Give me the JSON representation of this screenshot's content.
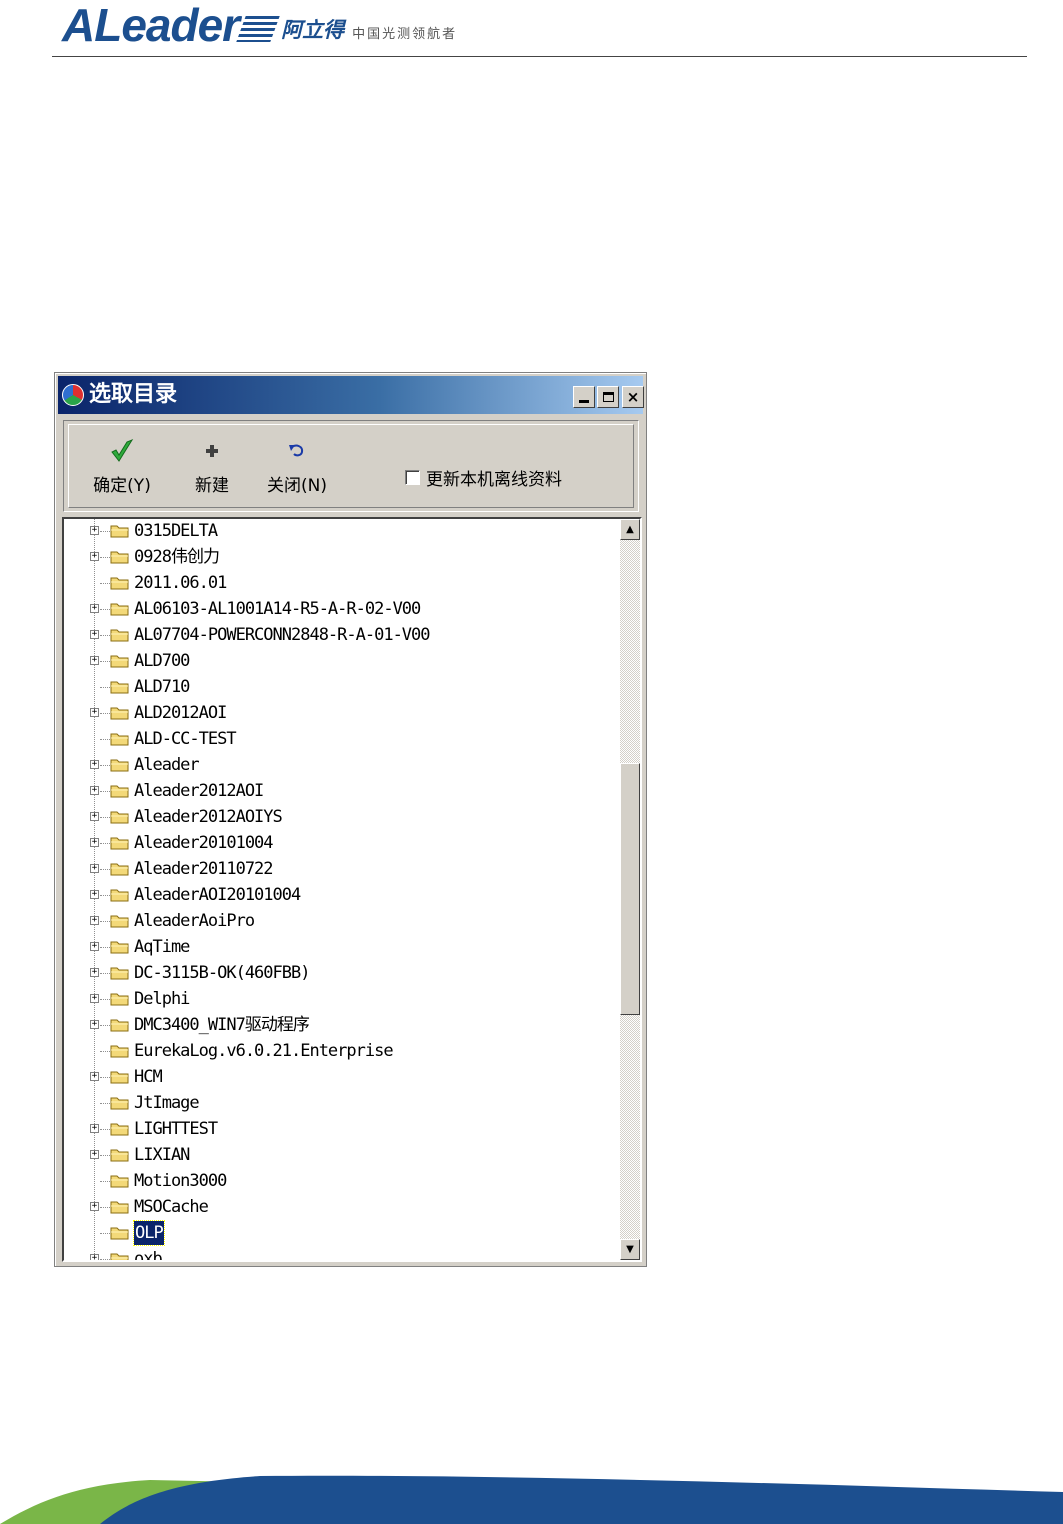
{
  "header": {
    "logo_text": "ALeader",
    "brand_cn": "阿立得",
    "slogan": "中国光测领航者"
  },
  "colors": {
    "brand_blue": "#1c4f8f",
    "title_bar": "#0a246a",
    "selection": "#0a246a",
    "footer_green": "#7ab648"
  },
  "dialog": {
    "title": "选取目录",
    "icon": "app-icon",
    "controls": {
      "minimize": "minimize-icon",
      "maximize": "maximize-icon",
      "close": "×"
    },
    "toolbar": {
      "ok_label": "确定(Y)",
      "ok_icon": "✔",
      "new_label": "新建",
      "new_icon": "✚",
      "close_label": "关闭(N)",
      "close_icon": "↶",
      "checkbox_label": "更新本机离线资料",
      "checkbox_checked": false
    },
    "tree": {
      "items": [
        {
          "label": "0315DELTA",
          "expandable": true
        },
        {
          "label": "0928伟创力",
          "expandable": true
        },
        {
          "label": "2011.06.01",
          "expandable": false
        },
        {
          "label": "AL06103-AL1001A14-R5-A-R-02-V00",
          "expandable": true
        },
        {
          "label": "AL07704-POWERCONN2848-R-A-01-V00",
          "expandable": true
        },
        {
          "label": "ALD700",
          "expandable": true
        },
        {
          "label": "ALD710",
          "expandable": false
        },
        {
          "label": "ALD2012AOI",
          "expandable": true
        },
        {
          "label": "ALD-CC-TEST",
          "expandable": false
        },
        {
          "label": "Aleader",
          "expandable": true
        },
        {
          "label": "Aleader2012AOI",
          "expandable": true
        },
        {
          "label": "Aleader2012AOIYS",
          "expandable": true
        },
        {
          "label": "Aleader20101004",
          "expandable": true
        },
        {
          "label": "Aleader20110722",
          "expandable": true
        },
        {
          "label": "AleaderAOI20101004",
          "expandable": true
        },
        {
          "label": "AleaderAoiPro",
          "expandable": true
        },
        {
          "label": "AqTime",
          "expandable": true
        },
        {
          "label": "DC-3115B-OK(460FBB)",
          "expandable": true
        },
        {
          "label": "Delphi",
          "expandable": true
        },
        {
          "label": "DMC3400_WIN7驱动程序",
          "expandable": true
        },
        {
          "label": "EurekaLog.v6.0.21.Enterprise",
          "expandable": false
        },
        {
          "label": "HCM",
          "expandable": true
        },
        {
          "label": "JtImage",
          "expandable": false
        },
        {
          "label": "LIGHTTEST",
          "expandable": true
        },
        {
          "label": "LIXIAN",
          "expandable": true
        },
        {
          "label": "Motion3000",
          "expandable": false
        },
        {
          "label": "MSOCache",
          "expandable": true
        },
        {
          "label": "OLP",
          "expandable": false,
          "selected": true
        },
        {
          "label": "oxb",
          "expandable": true
        }
      ],
      "scroll_up": "▲",
      "scroll_down": "▼"
    }
  }
}
